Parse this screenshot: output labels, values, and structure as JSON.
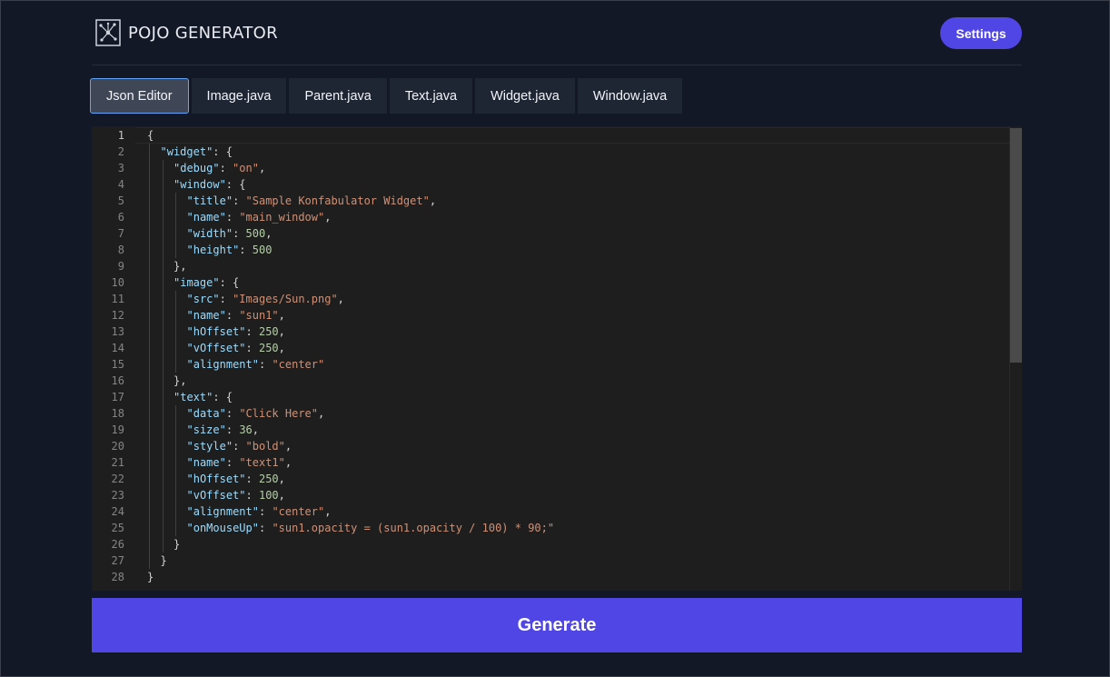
{
  "header": {
    "logo_icon": "network-nodes-icon",
    "title": "POJO GENERATOR",
    "settings_label": "Settings"
  },
  "tabs": [
    {
      "label": "Json Editor",
      "active": true
    },
    {
      "label": "Image.java",
      "active": false
    },
    {
      "label": "Parent.java",
      "active": false
    },
    {
      "label": "Text.java",
      "active": false
    },
    {
      "label": "Widget.java",
      "active": false
    },
    {
      "label": "Window.java",
      "active": false
    }
  ],
  "editor": {
    "current_line": 1,
    "lines": [
      {
        "indent": 0,
        "tokens": [
          {
            "t": "p",
            "v": "{"
          }
        ]
      },
      {
        "indent": 1,
        "tokens": [
          {
            "t": "k",
            "v": "\"widget\""
          },
          {
            "t": "p",
            "v": ": {"
          }
        ]
      },
      {
        "indent": 2,
        "tokens": [
          {
            "t": "k",
            "v": "\"debug\""
          },
          {
            "t": "p",
            "v": ": "
          },
          {
            "t": "s",
            "v": "\"on\""
          },
          {
            "t": "p",
            "v": ","
          }
        ]
      },
      {
        "indent": 2,
        "tokens": [
          {
            "t": "k",
            "v": "\"window\""
          },
          {
            "t": "p",
            "v": ": {"
          }
        ]
      },
      {
        "indent": 3,
        "tokens": [
          {
            "t": "k",
            "v": "\"title\""
          },
          {
            "t": "p",
            "v": ": "
          },
          {
            "t": "s",
            "v": "\"Sample Konfabulator Widget\""
          },
          {
            "t": "p",
            "v": ","
          }
        ]
      },
      {
        "indent": 3,
        "tokens": [
          {
            "t": "k",
            "v": "\"name\""
          },
          {
            "t": "p",
            "v": ": "
          },
          {
            "t": "s",
            "v": "\"main_window\""
          },
          {
            "t": "p",
            "v": ","
          }
        ]
      },
      {
        "indent": 3,
        "tokens": [
          {
            "t": "k",
            "v": "\"width\""
          },
          {
            "t": "p",
            "v": ": "
          },
          {
            "t": "n",
            "v": "500"
          },
          {
            "t": "p",
            "v": ","
          }
        ]
      },
      {
        "indent": 3,
        "tokens": [
          {
            "t": "k",
            "v": "\"height\""
          },
          {
            "t": "p",
            "v": ": "
          },
          {
            "t": "n",
            "v": "500"
          }
        ]
      },
      {
        "indent": 2,
        "tokens": [
          {
            "t": "p",
            "v": "},"
          }
        ]
      },
      {
        "indent": 2,
        "tokens": [
          {
            "t": "k",
            "v": "\"image\""
          },
          {
            "t": "p",
            "v": ": {"
          }
        ]
      },
      {
        "indent": 3,
        "tokens": [
          {
            "t": "k",
            "v": "\"src\""
          },
          {
            "t": "p",
            "v": ": "
          },
          {
            "t": "s",
            "v": "\"Images/Sun.png\""
          },
          {
            "t": "p",
            "v": ","
          }
        ]
      },
      {
        "indent": 3,
        "tokens": [
          {
            "t": "k",
            "v": "\"name\""
          },
          {
            "t": "p",
            "v": ": "
          },
          {
            "t": "s",
            "v": "\"sun1\""
          },
          {
            "t": "p",
            "v": ","
          }
        ]
      },
      {
        "indent": 3,
        "tokens": [
          {
            "t": "k",
            "v": "\"hOffset\""
          },
          {
            "t": "p",
            "v": ": "
          },
          {
            "t": "n",
            "v": "250"
          },
          {
            "t": "p",
            "v": ","
          }
        ]
      },
      {
        "indent": 3,
        "tokens": [
          {
            "t": "k",
            "v": "\"vOffset\""
          },
          {
            "t": "p",
            "v": ": "
          },
          {
            "t": "n",
            "v": "250"
          },
          {
            "t": "p",
            "v": ","
          }
        ]
      },
      {
        "indent": 3,
        "tokens": [
          {
            "t": "k",
            "v": "\"alignment\""
          },
          {
            "t": "p",
            "v": ": "
          },
          {
            "t": "s",
            "v": "\"center\""
          }
        ]
      },
      {
        "indent": 2,
        "tokens": [
          {
            "t": "p",
            "v": "},"
          }
        ]
      },
      {
        "indent": 2,
        "tokens": [
          {
            "t": "k",
            "v": "\"text\""
          },
          {
            "t": "p",
            "v": ": {"
          }
        ]
      },
      {
        "indent": 3,
        "tokens": [
          {
            "t": "k",
            "v": "\"data\""
          },
          {
            "t": "p",
            "v": ": "
          },
          {
            "t": "s",
            "v": "\"Click Here\""
          },
          {
            "t": "p",
            "v": ","
          }
        ]
      },
      {
        "indent": 3,
        "tokens": [
          {
            "t": "k",
            "v": "\"size\""
          },
          {
            "t": "p",
            "v": ": "
          },
          {
            "t": "n",
            "v": "36"
          },
          {
            "t": "p",
            "v": ","
          }
        ]
      },
      {
        "indent": 3,
        "tokens": [
          {
            "t": "k",
            "v": "\"style\""
          },
          {
            "t": "p",
            "v": ": "
          },
          {
            "t": "s",
            "v": "\"bold\""
          },
          {
            "t": "p",
            "v": ","
          }
        ]
      },
      {
        "indent": 3,
        "tokens": [
          {
            "t": "k",
            "v": "\"name\""
          },
          {
            "t": "p",
            "v": ": "
          },
          {
            "t": "s",
            "v": "\"text1\""
          },
          {
            "t": "p",
            "v": ","
          }
        ]
      },
      {
        "indent": 3,
        "tokens": [
          {
            "t": "k",
            "v": "\"hOffset\""
          },
          {
            "t": "p",
            "v": ": "
          },
          {
            "t": "n",
            "v": "250"
          },
          {
            "t": "p",
            "v": ","
          }
        ]
      },
      {
        "indent": 3,
        "tokens": [
          {
            "t": "k",
            "v": "\"vOffset\""
          },
          {
            "t": "p",
            "v": ": "
          },
          {
            "t": "n",
            "v": "100"
          },
          {
            "t": "p",
            "v": ","
          }
        ]
      },
      {
        "indent": 3,
        "tokens": [
          {
            "t": "k",
            "v": "\"alignment\""
          },
          {
            "t": "p",
            "v": ": "
          },
          {
            "t": "s",
            "v": "\"center\""
          },
          {
            "t": "p",
            "v": ","
          }
        ]
      },
      {
        "indent": 3,
        "tokens": [
          {
            "t": "k",
            "v": "\"onMouseUp\""
          },
          {
            "t": "p",
            "v": ": "
          },
          {
            "t": "s",
            "v": "\"sun1.opacity = (sun1.opacity / 100) * 90;\""
          }
        ]
      },
      {
        "indent": 2,
        "tokens": [
          {
            "t": "p",
            "v": "}"
          }
        ]
      },
      {
        "indent": 1,
        "tokens": [
          {
            "t": "p",
            "v": "}"
          }
        ]
      },
      {
        "indent": 0,
        "tokens": [
          {
            "t": "p",
            "v": "}"
          }
        ]
      }
    ]
  },
  "footer": {
    "generate_label": "Generate"
  },
  "colors": {
    "accent": "#4f46e5",
    "background": "#121826",
    "editor_bg": "#1e1e1e",
    "json_key": "#9cdcfe",
    "json_string": "#ce9178",
    "json_number": "#b5cea8",
    "active_tab_border": "#60a5fa"
  }
}
